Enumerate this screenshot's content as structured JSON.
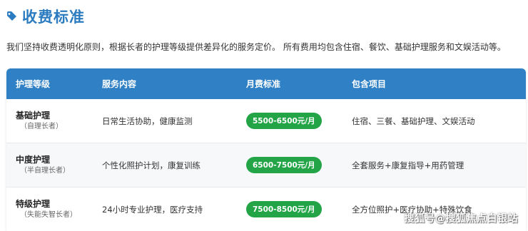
{
  "header": {
    "title": "收费标准",
    "icon": "tag-icon"
  },
  "intro": "我们坚持收费透明化原则，根据长者的护理等级提供差异化的服务定价。 所有费用均包含住宿、餐饮、基础护理服务和文娱活动等。",
  "table": {
    "headers": [
      "护理等级",
      "服务内容",
      "月费标准",
      "包含项目"
    ],
    "rows": [
      {
        "level": "基础护理",
        "sub": "（自理长者）",
        "service": "日常生活协助，健康监测",
        "price": "5500-6500元/月",
        "includes": "住宿、三餐、基础护理、文娱活动"
      },
      {
        "level": "中度护理",
        "sub": "（半自理长者）",
        "service": "个性化照护计划，康复训练",
        "price": "6500-7500元/月",
        "includes": "全套服务+康复指导+用药管理"
      },
      {
        "level": "特级护理",
        "sub": "（失能失智长者）",
        "service": "24小时专业护理，医疗支持",
        "price": "7500-8500元/月",
        "includes": "全方位照护+医疗协助+特殊饮食"
      }
    ]
  },
  "watermark": "搜狐号@搜狐焦点白银站",
  "colors": {
    "accent": "#2b7bc0",
    "header_bg": "#2f80c4",
    "price_badge": "#22a447"
  }
}
